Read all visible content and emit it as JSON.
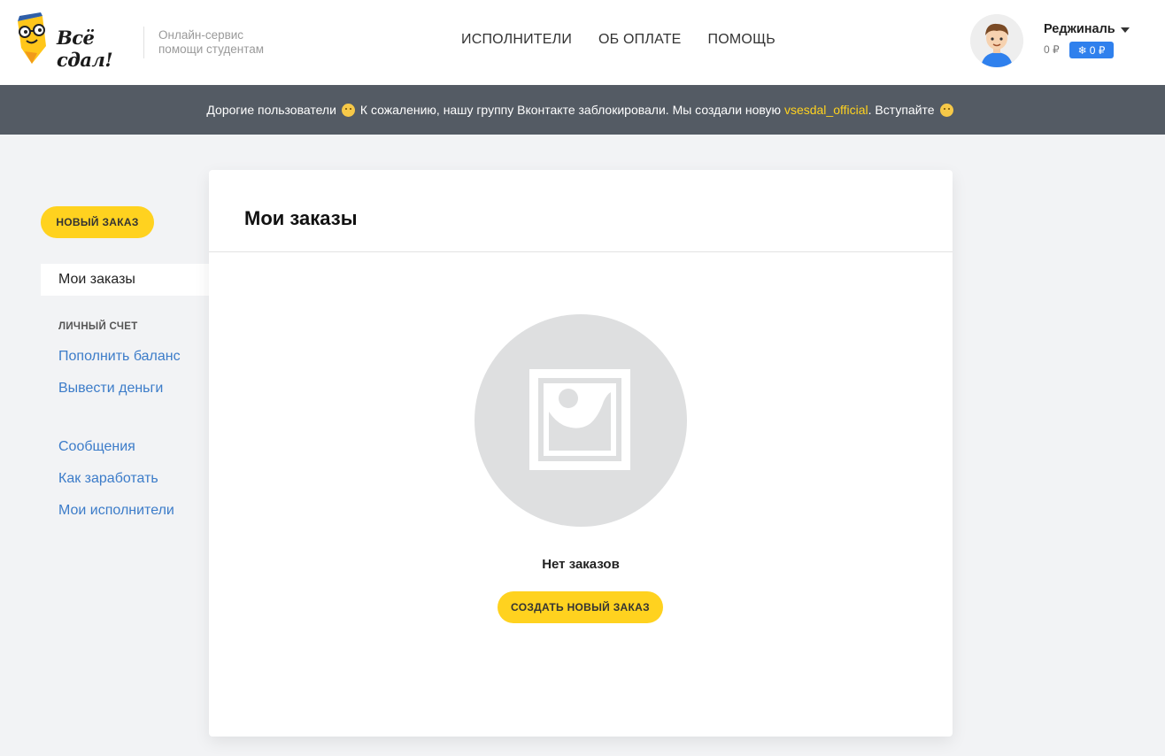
{
  "header": {
    "logo_text": "Всё сдал!",
    "tagline_line1": "Онлайн-сервис",
    "tagline_line2": "помощи студентам",
    "nav": [
      "ИСПОЛНИТЕЛИ",
      "ОБ ОПЛАТЕ",
      "ПОМОЩЬ"
    ],
    "user": {
      "name": "Реджиналь",
      "balance": "0 ₽",
      "bonus": "0 ₽",
      "bonus_icon": "snowflake-icon"
    }
  },
  "banner": {
    "text_before": "Дорогие пользователи",
    "text_middle": "К сожалению, нашу группу Вконтакте заблокировали. Мы создали новую",
    "link": "vsesdal_official",
    "text_after": ". Вступайте"
  },
  "sidebar": {
    "new_order": "НОВЫЙ ЗАКАЗ",
    "active_item": "Мои заказы",
    "section_title": "ЛИЧНЫЙ СЧЕТ",
    "account_links": [
      "Пополнить баланс",
      "Вывести деньги"
    ],
    "links": [
      "Сообщения",
      "Как заработать",
      "Мои исполнители"
    ]
  },
  "main": {
    "title": "Мои заказы",
    "empty_icon": "image-placeholder-icon",
    "empty_text": "Нет заказов",
    "create_button": "СОЗДАТЬ НОВЫЙ ЗАКАЗ"
  },
  "colors": {
    "accent": "#ffd21f",
    "link": "#3c7cc9",
    "banner": "#545b64",
    "bonus": "#2f80ed"
  }
}
